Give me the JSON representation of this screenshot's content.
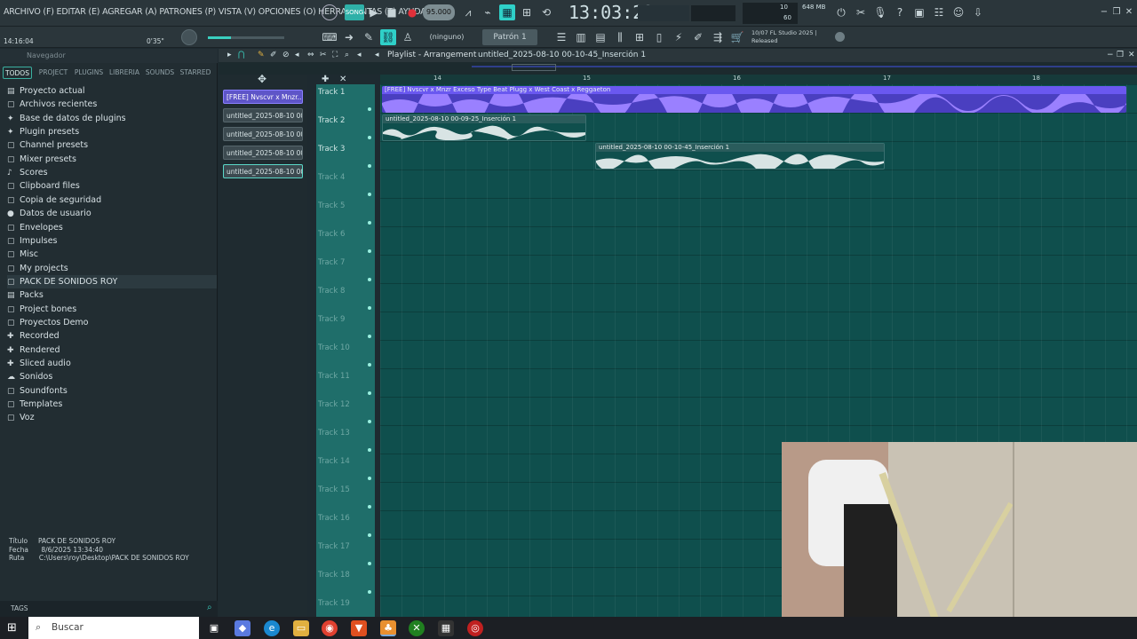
{
  "menu": {
    "text": "ARCHIVO (F) EDITAR (E) AGREGAR (A) PATRONES (P) VISTA (V) OPCIONES (O) HERRAMIENTAS (T) AYUDA"
  },
  "transport": {
    "song_label": "SONG",
    "tempo": "95.000",
    "time": "13:03:23"
  },
  "cpu": {
    "value1": "10",
    "value2": "60",
    "mem": "648 MB"
  },
  "time_small": "14:16:04",
  "time_small2": "0'35\"",
  "toolbar": {
    "ninguno": "(ninguno)",
    "pattern": "Patrón 1",
    "version_line1": "10/07  FL Studio 2025 |",
    "version_line2": "Released"
  },
  "browser": {
    "header": "Navegador",
    "tabs": [
      "TODOS",
      "PROJECT",
      "PLUGINS",
      "LIBRERIA",
      "SOUNDS",
      "STARRED"
    ],
    "items": [
      {
        "label": "Proyecto actual",
        "icon": "▤"
      },
      {
        "label": "Archivos recientes",
        "icon": "▢"
      },
      {
        "label": "Base de datos de plugins",
        "icon": "✦"
      },
      {
        "label": "Plugin presets",
        "icon": "✦"
      },
      {
        "label": "Channel presets",
        "icon": "▢"
      },
      {
        "label": "Mixer presets",
        "icon": "▢"
      },
      {
        "label": "Scores",
        "icon": "♪"
      },
      {
        "label": "Clipboard files",
        "icon": "▢"
      },
      {
        "label": "Copia de seguridad",
        "icon": "▢"
      },
      {
        "label": "Datos de usuario",
        "icon": "●"
      },
      {
        "label": "Envelopes",
        "icon": "▢"
      },
      {
        "label": "Impulses",
        "icon": "▢"
      },
      {
        "label": "Misc",
        "icon": "▢"
      },
      {
        "label": "My projects",
        "icon": "▢"
      },
      {
        "label": "PACK DE SONIDOS ROY",
        "icon": "▢"
      },
      {
        "label": "Packs",
        "icon": "▤"
      },
      {
        "label": "Project bones",
        "icon": "▢"
      },
      {
        "label": "Proyectos Demo",
        "icon": "▢"
      },
      {
        "label": "Recorded",
        "icon": "✚"
      },
      {
        "label": "Rendered",
        "icon": "✚"
      },
      {
        "label": "Sliced audio",
        "icon": "✚"
      },
      {
        "label": "Sonidos",
        "icon": "☁"
      },
      {
        "label": "Soundfonts",
        "icon": "▢"
      },
      {
        "label": "Templates",
        "icon": "▢"
      },
      {
        "label": "Voz",
        "icon": "▢"
      }
    ],
    "info": {
      "titulo_label": "Título",
      "titulo": "PACK DE SONIDOS ROY",
      "fecha_label": "Fecha",
      "fecha": "8/6/2025 13:34:40",
      "ruta_label": "Ruta",
      "ruta": "C:\\Users\\roy\\Desktop\\PACK DE SONIDOS ROY"
    },
    "tags_label": "TAGS"
  },
  "channel_clips": [
    "[FREE] Nvscvr x Mnzr...",
    "untitled_2025-08-10 00-...",
    "untitled_2025-08-10 00-...",
    "untitled_2025-08-10 00-...",
    "untitled_2025-08-10 00-..."
  ],
  "playlist": {
    "title": "Playlist - Arrangement",
    "breadcrumb": "untitled_2025-08-10 00-10-45_Inserción 1",
    "ruler": [
      "14",
      "15",
      "16",
      "17",
      "18"
    ],
    "tracks": [
      "Track 1",
      "Track 2",
      "Track 3",
      "Track 4",
      "Track 5",
      "Track 6",
      "Track 7",
      "Track 8",
      "Track 9",
      "Track 10",
      "Track 11",
      "Track 12",
      "Track 13",
      "Track 14",
      "Track 15",
      "Track 16",
      "Track 17",
      "Track 18",
      "Track 19"
    ],
    "clips": [
      {
        "label": "[FREE] Nvscvr x Mnzr Exceso Type Beat  Plugg x West Coast x Reggaeton"
      },
      {
        "label": "untitled_2025-08-10 00-09-25_Inserción 1"
      },
      {
        "label": "untitled_2025-08-10 00-10-45_Inserción 1"
      }
    ]
  },
  "taskbar": {
    "search": "Buscar"
  },
  "colors": {
    "accent": "#3ab0a0",
    "clip_purple": "#7a5cf0",
    "playlist_bg": "#0f4f4d"
  }
}
